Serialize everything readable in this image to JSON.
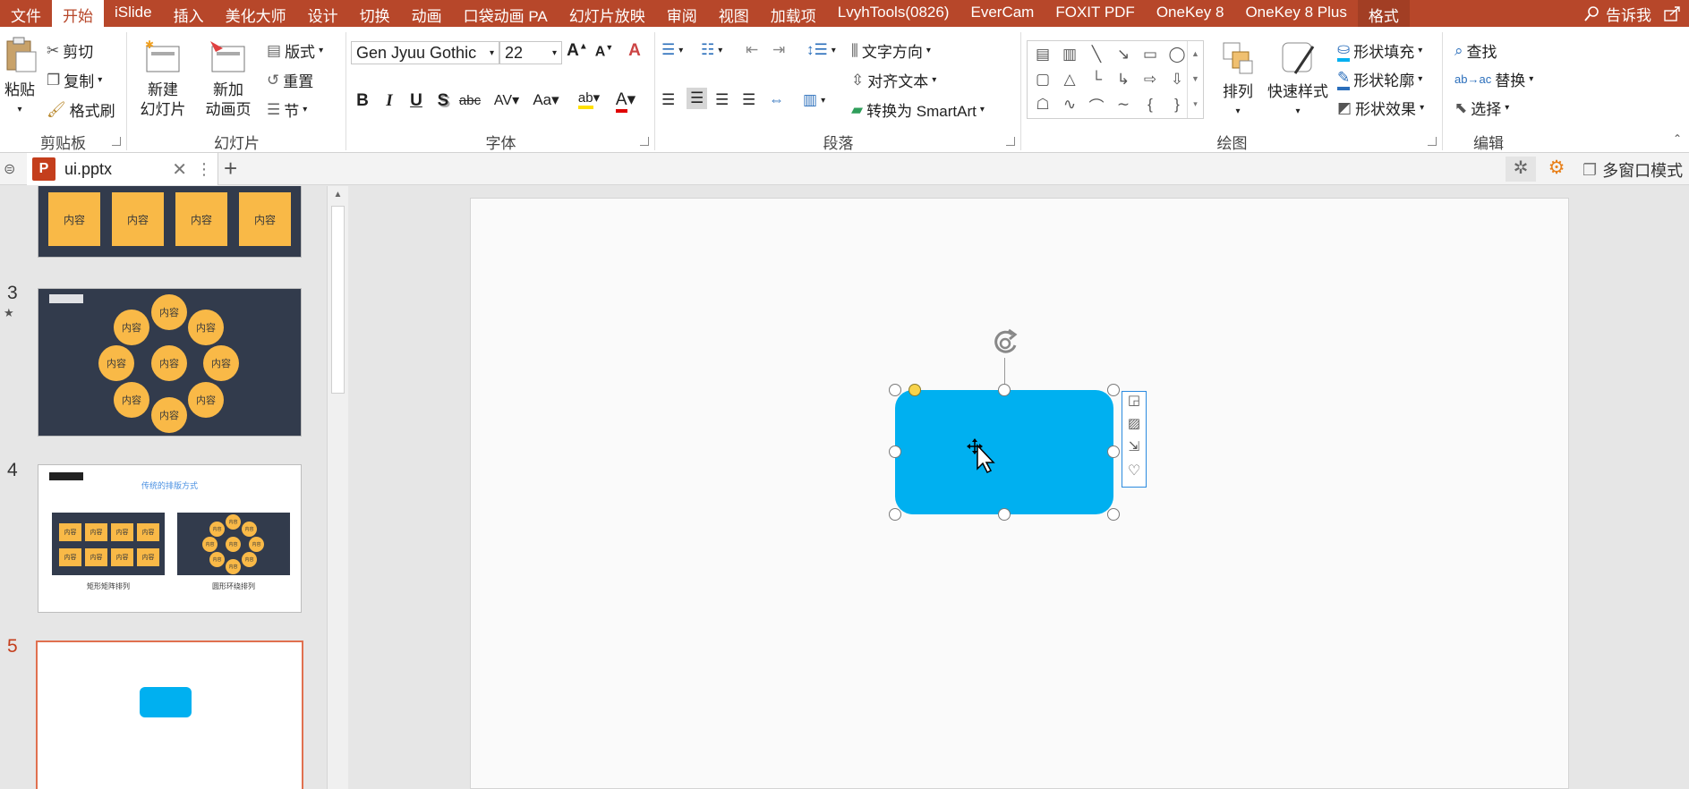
{
  "ribbon_tabs": [
    "文件",
    "开始",
    "iSlide",
    "插入",
    "美化大师",
    "设计",
    "切换",
    "动画",
    "口袋动画 PA",
    "幻灯片放映",
    "审阅",
    "视图",
    "加载项",
    "LvyhTools(0826)",
    "EverCam",
    "FOXIT PDF",
    "OneKey 8",
    "OneKey 8 Plus",
    "格式"
  ],
  "active_tab": "开始",
  "tell_me": "告诉我",
  "clipboard": {
    "paste": "粘贴",
    "cut": "剪切",
    "copy": "复制",
    "format_painter": "格式刷",
    "label": "剪贴板"
  },
  "slides_group": {
    "new_slide_1": "新建",
    "new_slide_2": "幻灯片",
    "new_anim_1": "新加",
    "new_anim_2": "动画页",
    "layout": "版式",
    "reset": "重置",
    "section": "节",
    "label": "幻灯片"
  },
  "font_group": {
    "font_name": "Gen Jyuu Gothic",
    "font_size": "22",
    "label": "字体"
  },
  "paragraph_group": {
    "text_direction": "文字方向",
    "align_text": "对齐文本",
    "smartart": "转换为 SmartArt",
    "label": "段落"
  },
  "drawing_group": {
    "arrange": "排列",
    "quick_styles": "快速样式",
    "shape_fill": "形状填充",
    "shape_outline": "形状轮廓",
    "shape_effects": "形状效果",
    "label": "绘图"
  },
  "editing_group": {
    "find": "查找",
    "replace": "替换",
    "select": "选择",
    "label": "编辑"
  },
  "doc_tab": {
    "filename": "ui.pptx",
    "window_mode": "多窗口模式"
  },
  "thumbnails": {
    "box_label": "内容",
    "slide_numbers": [
      "3",
      "4",
      "5"
    ],
    "slide4_title": "传统的排版方式",
    "slide4_caption_left": "矩形矩阵排列",
    "slide4_caption_right": "圆形环绕排列"
  },
  "colors": {
    "accent_orange": "#b7472a",
    "shape_blue": "#00b0f0",
    "thumb_yellow": "#f9b947",
    "thumb_dark": "#323b4c"
  }
}
